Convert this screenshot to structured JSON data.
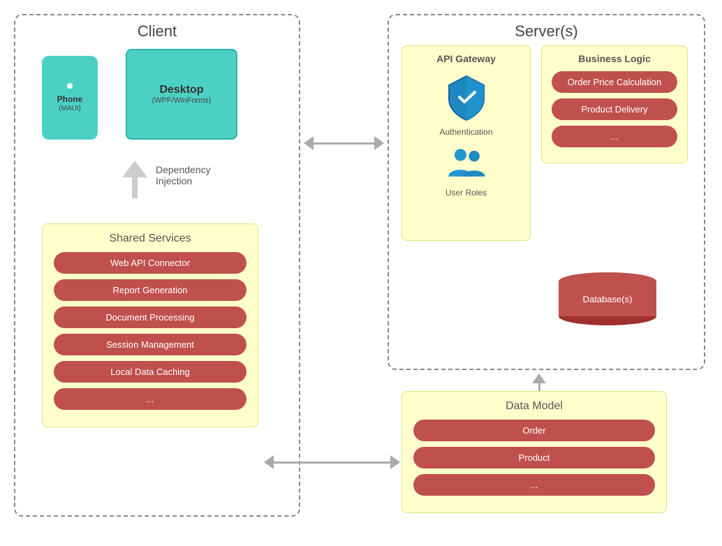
{
  "client": {
    "title": "Client",
    "phone": {
      "label": "Phone",
      "sublabel": "(MAUI)"
    },
    "desktop": {
      "label": "Desktop",
      "sublabel": "(WPF/WinForms)"
    },
    "dependency_injection": {
      "line1": "Dependency",
      "line2": "Injection"
    },
    "shared_services": {
      "title": "Shared Services",
      "items": [
        "Web API Connector",
        "Report Generation",
        "Document Processing",
        "Session Management",
        "Local Data Caching",
        "..."
      ]
    }
  },
  "server": {
    "title": "Server(s)",
    "api_gateway": {
      "title": "API Gateway",
      "authentication_label": "Authentication",
      "user_roles_label": "User Roles"
    },
    "business_logic": {
      "title": "Business Logic",
      "items": [
        "Order Price Calculation",
        "Product Delivery",
        "..."
      ]
    },
    "database": {
      "label": "Database(s)"
    }
  },
  "data_model": {
    "title": "Data Model",
    "items": [
      "Order",
      "Product",
      "..."
    ]
  }
}
